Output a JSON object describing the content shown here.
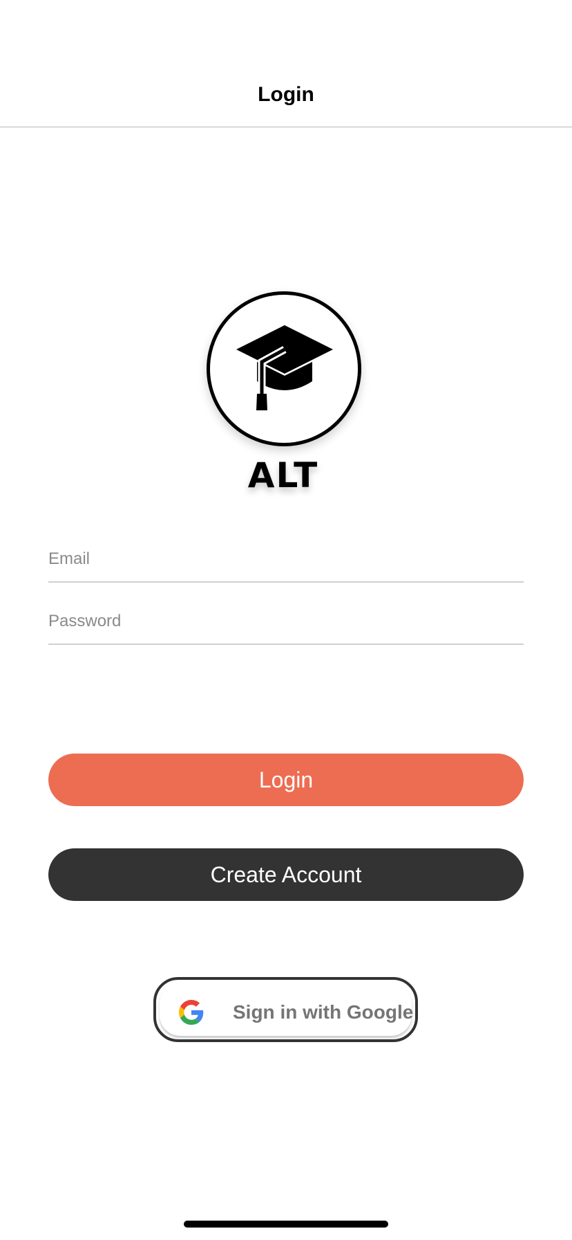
{
  "nav": {
    "title": "Login"
  },
  "logo": {
    "text": "ALT",
    "icon": "graduation-cap-icon"
  },
  "form": {
    "email_placeholder": "Email",
    "email_value": "",
    "password_placeholder": "Password",
    "password_value": ""
  },
  "buttons": {
    "login_label": "Login",
    "create_account_label": "Create Account",
    "google_label": "Sign in with Google"
  },
  "colors": {
    "login_button": "#ED6D52",
    "create_account_button": "#333333",
    "google_label": "#757575"
  }
}
